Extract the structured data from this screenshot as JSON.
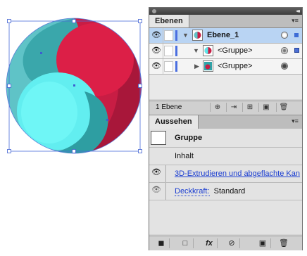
{
  "layers_panel": {
    "tab": "Ebenen",
    "rows": [
      {
        "name": "Ebene_1"
      },
      {
        "name": "<Gruppe>"
      },
      {
        "name": "<Gruppe>"
      }
    ],
    "footer_count": "1 Ebene"
  },
  "appearance_panel": {
    "tab": "Aussehen",
    "header": "Gruppe",
    "contents_label": "Inhalt",
    "effect_label": "3D-Extrudieren und abgeflachte Kan",
    "opacity_label": "Deckkraft:",
    "opacity_value": "Standard",
    "fx_label": "fx"
  },
  "colors": {
    "red": "#d11f45",
    "cyan": "#5be6ea",
    "teal": "#2fa4a8",
    "accent_blue": "#3d6cd6"
  }
}
